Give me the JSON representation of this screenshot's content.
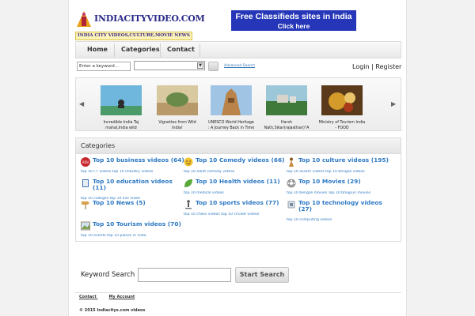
{
  "header": {
    "brand": "INDIACITYVIDEO.COM",
    "tagline": "INDIA CITY VIDEOS,CULTURE,MOVIE NEWS",
    "banner_line1": "Free Classifieds sites in India",
    "banner_line2": "Click here"
  },
  "nav": {
    "items": [
      "Home",
      "Categories",
      "Contact"
    ]
  },
  "search_bar": {
    "keyword_value": "Enter a keyword...",
    "category_selected": "",
    "advanced_label": "Advanced Search"
  },
  "auth": {
    "login": "Login",
    "separator": "|",
    "register": "Register"
  },
  "carousel": {
    "prev_icon": "chevron-left-icon",
    "next_icon": "chevron-right-icon",
    "items": [
      {
        "caption": "Incredible India Taj mahal,India wild"
      },
      {
        "caption": "Vignettes from Wild India!"
      },
      {
        "caption": "UNESCO World Heritage : A Journey Back in Time"
      },
      {
        "caption": "Harsh Nath,Sikar(rajasthan)\"A"
      },
      {
        "caption": "Ministry of Tourism India - FOOD"
      }
    ]
  },
  "categories": {
    "heading": "Categories",
    "items": [
      {
        "title": "Top 10 business videos (64)",
        "sub": "top 10 I.T videos top 10 industry videos",
        "icon": "adv-badge-icon"
      },
      {
        "title": "Top 10 Comedy videos (66)",
        "sub": "top 10 adult comedy videos",
        "icon": "smiley-icon"
      },
      {
        "title": "Top 10 culture videos (195)",
        "sub": "top 10 assam videos top 10 bengali videos",
        "icon": "figure-icon"
      },
      {
        "title": "Top 10 education videos (11)",
        "sub": "top 10 colleges top 10 live video",
        "icon": "book-icon"
      },
      {
        "title": "Top 10 Health videos (11)",
        "sub": "top 10 medical videos",
        "icon": "leaf-icon"
      },
      {
        "title": "Top 10 Movies (29)",
        "sub": "top 10 bengali movies Top 10 bhojpuri movies",
        "icon": "film-reel-icon"
      },
      {
        "title": "Top 10 News (5)",
        "sub": "",
        "icon": "signpost-icon"
      },
      {
        "title": "Top 10 sports videos (77)",
        "sub": "top 10 chess videos top 10 cricket videos",
        "icon": "athlete-icon"
      },
      {
        "title": "Top 10 technology videos (27)",
        "sub": "top 10 computing videos",
        "icon": "chip-icon"
      },
      {
        "title": "Top 10 Tourism videos (70)",
        "sub": "top 10 events top 10 places in india",
        "icon": "photo-icon"
      }
    ]
  },
  "keyword_search": {
    "label": "Keyword Search",
    "input_value": "",
    "button": "Start Search"
  },
  "footer": {
    "links": [
      "Contact",
      "My Account"
    ],
    "copyright": "© 2015 Indiacitys.com videos"
  }
}
